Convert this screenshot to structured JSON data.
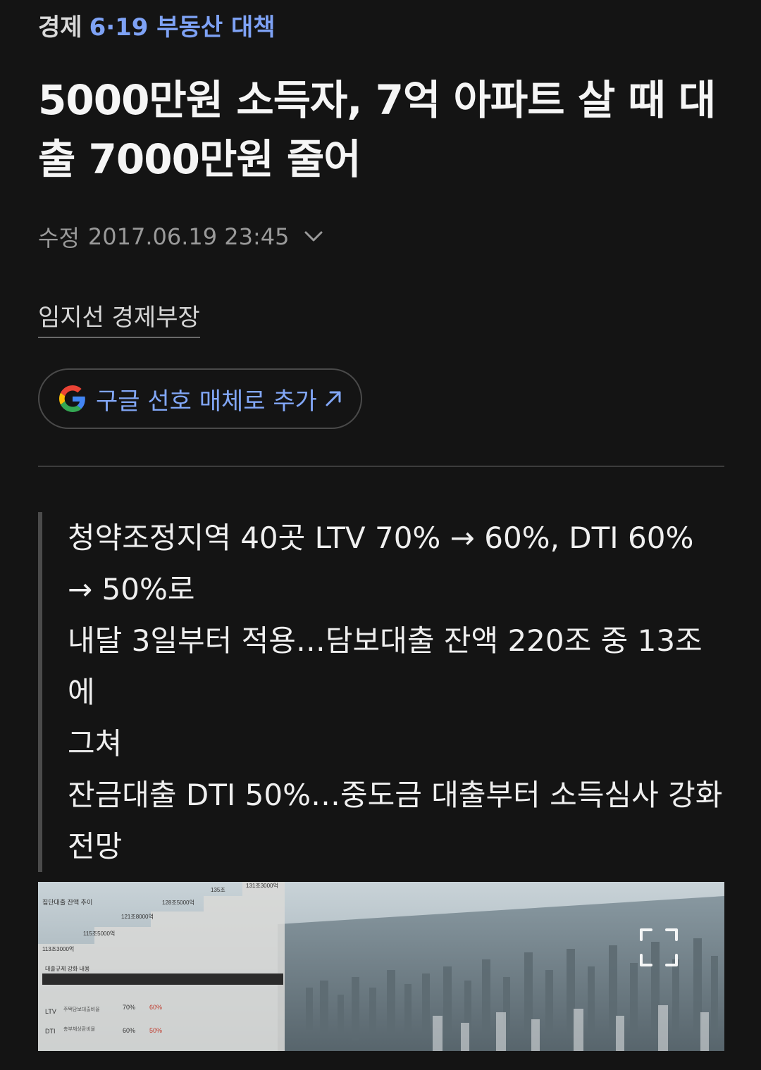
{
  "category": {
    "section": "경제",
    "topic": "6·19 부동산 대책"
  },
  "headline": {
    "line1": "5000만원 소득자, 7억 아파트 살 때 대",
    "line2": "출 7000만원 줄어"
  },
  "meta": {
    "label": "수정",
    "datetime": "2017.06.19 23:45"
  },
  "byline": "임지선 경제부장",
  "google_button": {
    "label": "구글 선호 매체로 추가",
    "arrow": "↗"
  },
  "summary": [
    "청약조정지역 40곳 LTV 70% → 60%, DTI 60%",
    "→ 50%로",
    "내달 3일부터 적용…담보대출 잔액 220조 중 13조에",
    "그쳐",
    "잔금대출 DTI 50%…중도금 대출부터 소득심사 강화",
    "전망"
  ],
  "photo_infographic": {
    "title": "집단대출 잔액 추이",
    "steps": [
      "113조3000억",
      "115조5000억",
      "121조8000억",
      "128조5000억",
      "135조",
      "131조3000억"
    ],
    "rules_title": "대출규제 강화 내용",
    "rows": [
      {
        "name": "LTV",
        "desc": "주택담보대출비율",
        "from": "70%",
        "to": "60%"
      },
      {
        "name": "DTI",
        "desc": "총부채상환비율",
        "from": "60%",
        "to": "50%"
      }
    ]
  },
  "icons": {
    "meta_toggle": "chevron-down-icon",
    "google": "google-g-icon",
    "external": "arrow-up-right-icon",
    "expand": "expand-icon"
  },
  "colors": {
    "background": "#141414",
    "accent_link": "#7ea2f5",
    "text": "#f0f0f0",
    "muted": "#9a9a9a"
  }
}
